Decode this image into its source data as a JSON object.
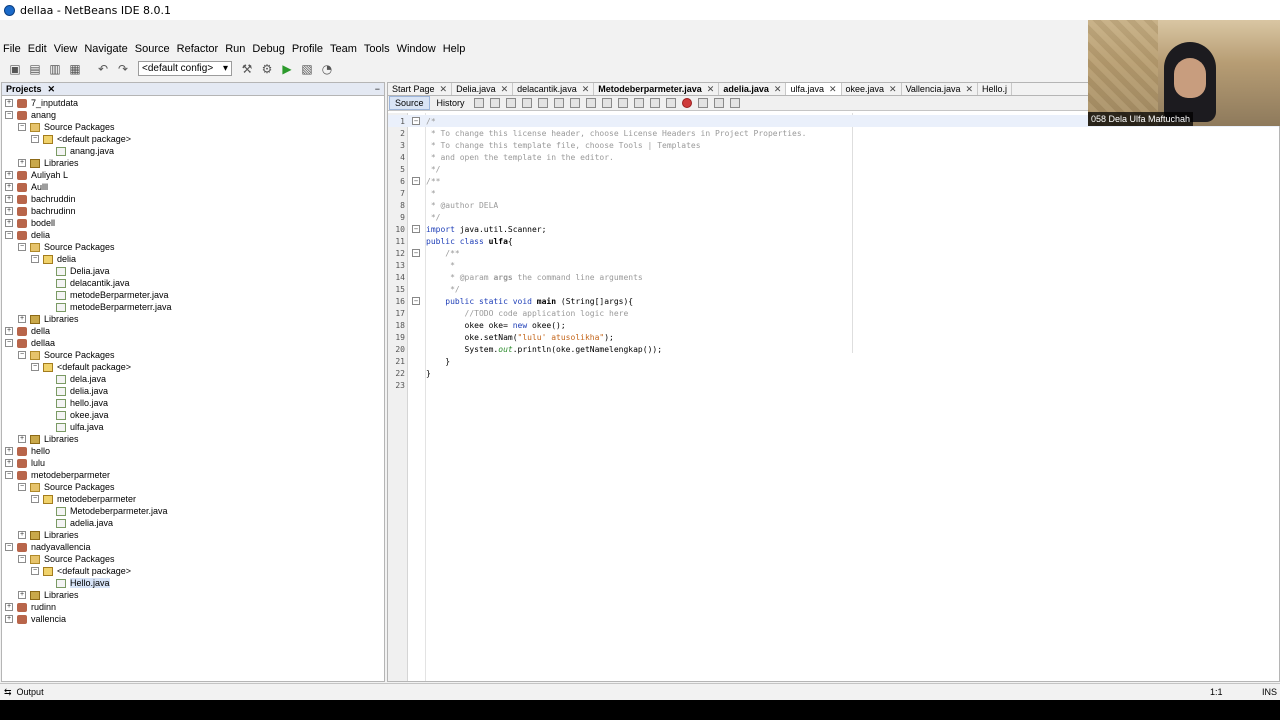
{
  "window": {
    "title": "dellaa - NetBeans IDE 8.0.1"
  },
  "menu": [
    "File",
    "Edit",
    "View",
    "Navigate",
    "Source",
    "Refactor",
    "Run",
    "Debug",
    "Profile",
    "Team",
    "Tools",
    "Window",
    "Help"
  ],
  "toolbar": {
    "config": "<default config>"
  },
  "projects_panel": {
    "title": "Projects",
    "minimize": "−",
    "tree": [
      {
        "label": "7_inputdata",
        "depth": 0,
        "type": "proj",
        "toggle": "+"
      },
      {
        "label": "anang",
        "depth": 0,
        "type": "proj",
        "toggle": "−"
      },
      {
        "label": "Source Packages",
        "depth": 1,
        "type": "src",
        "toggle": "−"
      },
      {
        "label": "<default package>",
        "depth": 2,
        "type": "pkg",
        "toggle": "−"
      },
      {
        "label": "anang.java",
        "depth": 3,
        "type": "java",
        "toggle": ""
      },
      {
        "label": "Libraries",
        "depth": 1,
        "type": "lib",
        "toggle": "+"
      },
      {
        "label": "Auliyah L",
        "depth": 0,
        "type": "proj",
        "toggle": "+"
      },
      {
        "label": "Aulll",
        "depth": 0,
        "type": "proj",
        "toggle": "+"
      },
      {
        "label": "bachruddin",
        "depth": 0,
        "type": "proj",
        "toggle": "+"
      },
      {
        "label": "bachrudinn",
        "depth": 0,
        "type": "proj",
        "toggle": "+"
      },
      {
        "label": "bodell",
        "depth": 0,
        "type": "proj",
        "toggle": "+"
      },
      {
        "label": "delia",
        "depth": 0,
        "type": "proj",
        "toggle": "−"
      },
      {
        "label": "Source Packages",
        "depth": 1,
        "type": "src",
        "toggle": "−"
      },
      {
        "label": "delia",
        "depth": 2,
        "type": "pkg",
        "toggle": "−"
      },
      {
        "label": "Delia.java",
        "depth": 3,
        "type": "java",
        "toggle": ""
      },
      {
        "label": "delacantik.java",
        "depth": 3,
        "type": "java",
        "toggle": ""
      },
      {
        "label": "metodeBerparmeter.java",
        "depth": 3,
        "type": "java",
        "toggle": ""
      },
      {
        "label": "metodeBerparmeterr.java",
        "depth": 3,
        "type": "java",
        "toggle": ""
      },
      {
        "label": "Libraries",
        "depth": 1,
        "type": "lib",
        "toggle": "+"
      },
      {
        "label": "della",
        "depth": 0,
        "type": "proj",
        "toggle": "+"
      },
      {
        "label": "dellaa",
        "depth": 0,
        "type": "proj",
        "toggle": "−"
      },
      {
        "label": "Source Packages",
        "depth": 1,
        "type": "src",
        "toggle": "−"
      },
      {
        "label": "<default package>",
        "depth": 2,
        "type": "pkg",
        "toggle": "−"
      },
      {
        "label": "dela.java",
        "depth": 3,
        "type": "java",
        "toggle": ""
      },
      {
        "label": "delia.java",
        "depth": 3,
        "type": "java",
        "toggle": ""
      },
      {
        "label": "hello.java",
        "depth": 3,
        "type": "java",
        "toggle": ""
      },
      {
        "label": "okee.java",
        "depth": 3,
        "type": "java",
        "toggle": ""
      },
      {
        "label": "ulfa.java",
        "depth": 3,
        "type": "java",
        "toggle": ""
      },
      {
        "label": "Libraries",
        "depth": 1,
        "type": "lib",
        "toggle": "+"
      },
      {
        "label": "hello",
        "depth": 0,
        "type": "proj",
        "toggle": "+"
      },
      {
        "label": "lulu",
        "depth": 0,
        "type": "proj",
        "toggle": "+"
      },
      {
        "label": "metodeberparmeter",
        "depth": 0,
        "type": "proj",
        "toggle": "−"
      },
      {
        "label": "Source Packages",
        "depth": 1,
        "type": "src",
        "toggle": "−"
      },
      {
        "label": "metodeberparmeter",
        "depth": 2,
        "type": "pkg",
        "toggle": "−"
      },
      {
        "label": "Metodeberparmeter.java",
        "depth": 3,
        "type": "java",
        "toggle": ""
      },
      {
        "label": "adelia.java",
        "depth": 3,
        "type": "java",
        "toggle": ""
      },
      {
        "label": "Libraries",
        "depth": 1,
        "type": "lib",
        "toggle": "+"
      },
      {
        "label": "nadyavallencia",
        "depth": 0,
        "type": "proj",
        "toggle": "−"
      },
      {
        "label": "Source Packages",
        "depth": 1,
        "type": "src",
        "toggle": "−"
      },
      {
        "label": "<default package>",
        "depth": 2,
        "type": "pkg",
        "toggle": "−"
      },
      {
        "label": "Hello.java",
        "depth": 3,
        "type": "java",
        "toggle": "",
        "selected": true
      },
      {
        "label": "Libraries",
        "depth": 1,
        "type": "lib",
        "toggle": "+"
      },
      {
        "label": "rudinn",
        "depth": 0,
        "type": "proj",
        "toggle": "+"
      },
      {
        "label": "vallencia",
        "depth": 0,
        "type": "proj",
        "toggle": "+"
      }
    ]
  },
  "editor": {
    "tabs": [
      {
        "label": "Start Page",
        "bold": false,
        "active": false
      },
      {
        "label": "Delia.java",
        "bold": false,
        "active": false
      },
      {
        "label": "delacantik.java",
        "bold": false,
        "active": false
      },
      {
        "label": "Metodeberparmeter.java",
        "bold": true,
        "active": false
      },
      {
        "label": "adelia.java",
        "bold": true,
        "active": false
      },
      {
        "label": "ulfa.java",
        "bold": false,
        "active": true
      },
      {
        "label": "okee.java",
        "bold": false,
        "active": false
      },
      {
        "label": "Vallencia.java",
        "bold": false,
        "active": false
      },
      {
        "label": "Hello.j",
        "bold": false,
        "active": false
      }
    ],
    "source_tab": "Source",
    "history_tab": "History",
    "lines": [
      {
        "n": "1",
        "fold": "−",
        "html": "<span class=\"cmt\">/*</span>"
      },
      {
        "n": "2",
        "fold": "",
        "html": "<span class=\"cmt\"> * To change this license header, choose License Headers in Project Properties.</span>"
      },
      {
        "n": "3",
        "fold": "",
        "html": "<span class=\"cmt\"> * To change this template file, choose Tools | Templates</span>"
      },
      {
        "n": "4",
        "fold": "",
        "html": "<span class=\"cmt\"> * and open the template in the editor.</span>"
      },
      {
        "n": "5",
        "fold": "",
        "html": "<span class=\"cmt\"> */</span>"
      },
      {
        "n": "6",
        "fold": "−",
        "html": "<span class=\"cmt\">/**</span>"
      },
      {
        "n": "7",
        "fold": "",
        "html": "<span class=\"cmt\"> *</span>"
      },
      {
        "n": "8",
        "fold": "",
        "html": "<span class=\"cmt\"> * @author DELA</span>"
      },
      {
        "n": "9",
        "fold": "",
        "html": "<span class=\"cmt\"> */</span>"
      },
      {
        "n": "10",
        "fold": "−",
        "html": "<span class=\"kw\">import</span> java.util.Scanner;"
      },
      {
        "n": "11",
        "fold": "",
        "html": "<span class=\"kw\">public class</span> <span class=\"bold\">ulfa</span>{"
      },
      {
        "n": "12",
        "fold": "−",
        "html": "    <span class=\"cmt\">/**</span>"
      },
      {
        "n": "13",
        "fold": "",
        "html": "<span class=\"cmt\">     *</span>"
      },
      {
        "n": "14",
        "fold": "",
        "html": "<span class=\"cmt\">     * @param <span class=\"bold\">args</span> the command line arguments</span>"
      },
      {
        "n": "15",
        "fold": "",
        "html": "<span class=\"cmt\">     */</span>"
      },
      {
        "n": "16",
        "fold": "−",
        "html": "    <span class=\"kw\">public static void</span> <span class=\"bold\">main</span> (String[]args){"
      },
      {
        "n": "17",
        "fold": "",
        "html": "        <span class=\"cmt\">//TODO code application logic here</span>"
      },
      {
        "n": "18",
        "fold": "",
        "html": "        okee oke= <span class=\"kw\">new</span> okee();"
      },
      {
        "n": "19",
        "fold": "",
        "html": "        oke.setNam(<span class=\"str\">\"lulu' atusolikha\"</span>);"
      },
      {
        "n": "20",
        "fold": "",
        "html": "        System.<span class=\"fld\">out</span>.println(oke.getNamelengkap());"
      },
      {
        "n": "21",
        "fold": "",
        "html": "    }"
      },
      {
        "n": "22",
        "fold": "",
        "html": "}"
      },
      {
        "n": "23",
        "fold": "",
        "html": ""
      }
    ]
  },
  "statusbar": {
    "output": "Output",
    "position": "1:1",
    "mode": "INS"
  },
  "webcam": {
    "caption": "058 Dela Ulfa Maftuchah"
  },
  "colors": {
    "keyword": "#1f3fb8",
    "comment": "#9a9a9a",
    "string": "#c4661b",
    "accent": "#d9e4f5"
  }
}
